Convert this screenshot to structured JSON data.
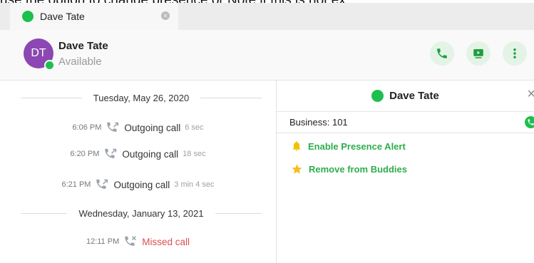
{
  "caption": "use the option to change presence or Note if this is not ex",
  "tab": {
    "title": "Dave Tate",
    "close": "×"
  },
  "header": {
    "avatar_initials": "DT",
    "name": "Dave Tate",
    "status": "Available"
  },
  "history": {
    "groups": [
      {
        "date": "Tuesday, May 26, 2020",
        "calls": [
          {
            "time": "6:06 PM",
            "label": "Outgoing call",
            "duration": "6 sec",
            "type": "outgoing"
          },
          {
            "time": "6:20 PM",
            "label": "Outgoing call",
            "duration": "18 sec",
            "type": "outgoing"
          },
          {
            "time": "6:21 PM",
            "label": "Outgoing call",
            "duration": "3 min 4 sec",
            "type": "outgoing"
          }
        ]
      },
      {
        "date": "Wednesday, January 13, 2021",
        "calls": [
          {
            "time": "12:11 PM",
            "label": "Missed call",
            "duration": "",
            "type": "missed"
          }
        ]
      }
    ]
  },
  "contact_panel": {
    "name": "Dave Tate",
    "close": "×",
    "phone_label": "Business: 101",
    "actions": [
      {
        "icon": "bell-icon",
        "label": "Enable Presence Alert"
      },
      {
        "icon": "star-icon",
        "label": "Remove from Buddies"
      }
    ]
  },
  "colors": {
    "presence_available": "#1dbf4e",
    "avatar": "#8c47b3",
    "accent_green": "#2fad4c",
    "missed_red": "#e04d4d",
    "bell": "#f2c200",
    "star": "#f5bd1f"
  }
}
